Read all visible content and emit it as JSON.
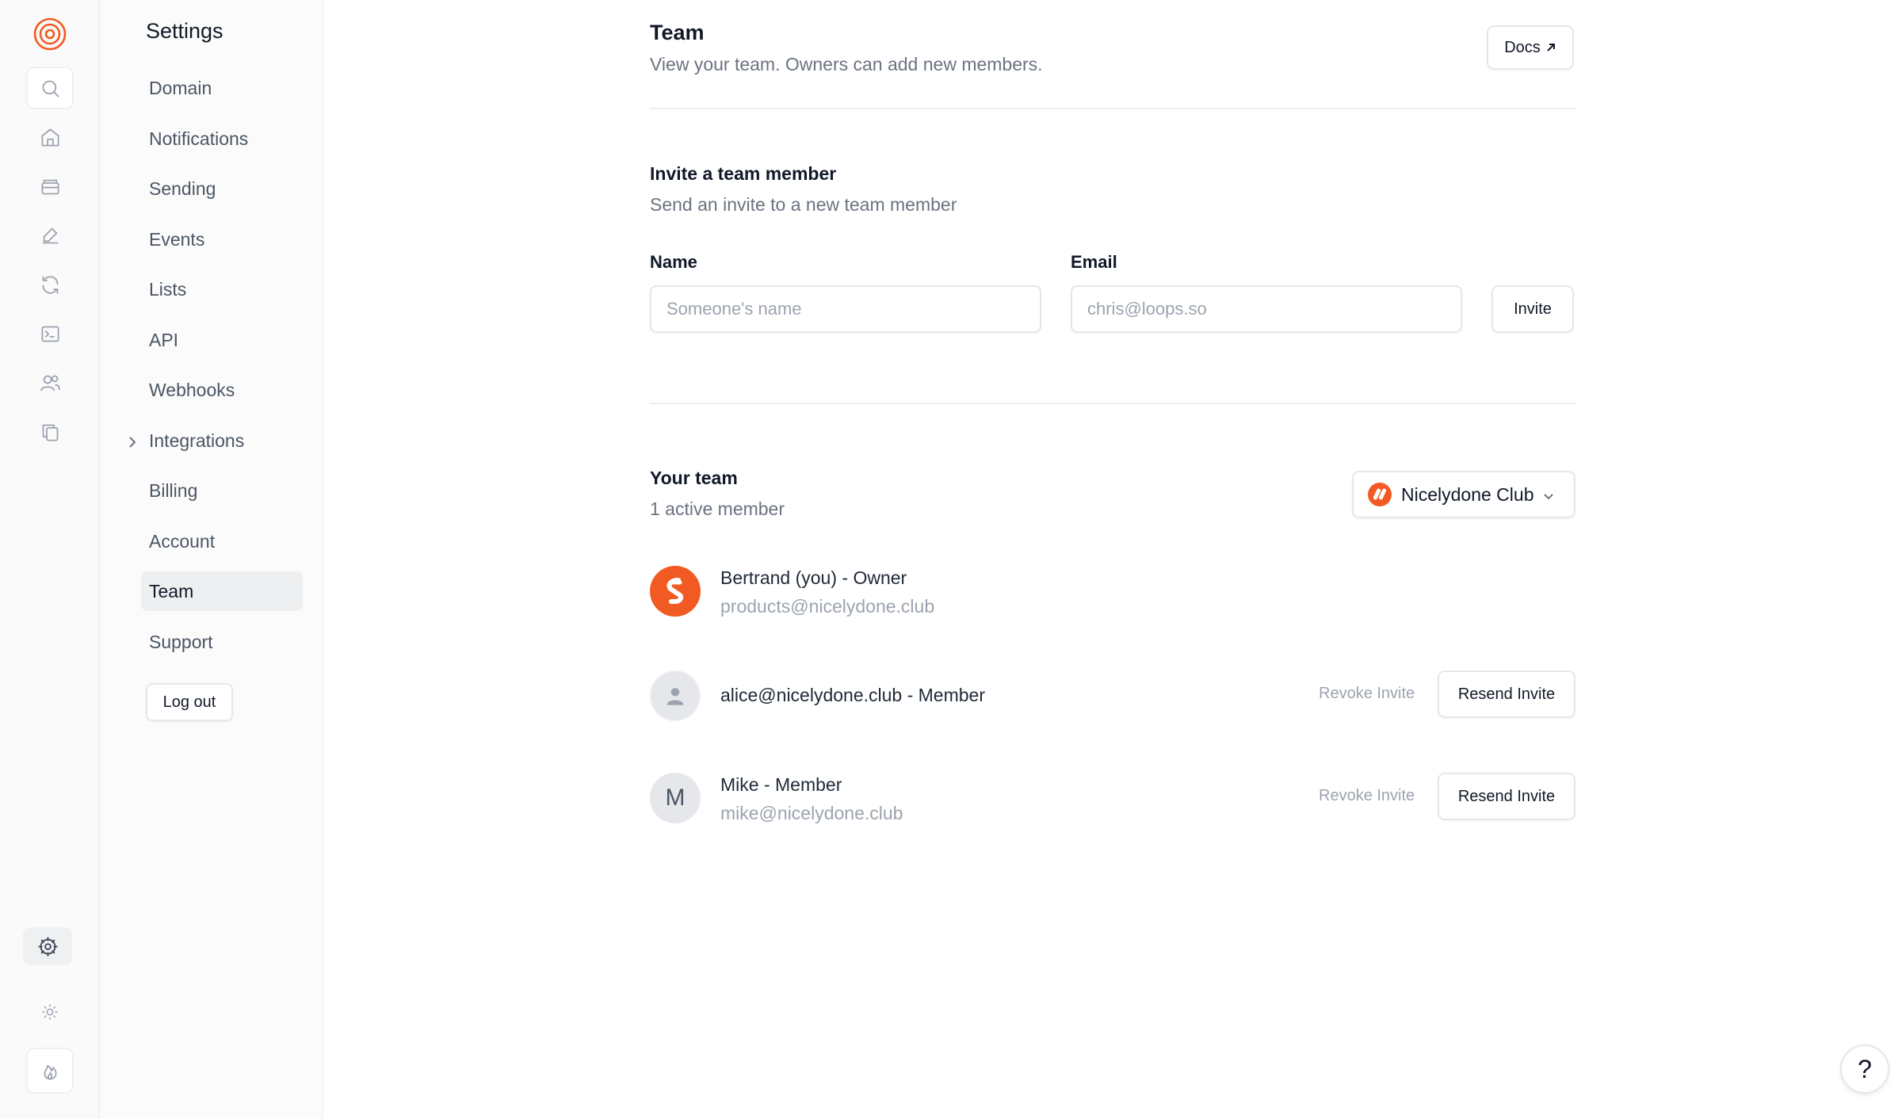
{
  "rail": {
    "icons": [
      "logo-icon",
      "search-icon",
      "home-icon",
      "inbox-icon",
      "edit-icon",
      "refresh-icon",
      "terminal-icon",
      "users-icon",
      "copy-icon",
      "settings-icon",
      "sun-icon",
      "fire-icon"
    ]
  },
  "sidebar": {
    "title": "Settings",
    "items": [
      {
        "label": "Domain"
      },
      {
        "label": "Notifications"
      },
      {
        "label": "Sending"
      },
      {
        "label": "Events"
      },
      {
        "label": "Lists"
      },
      {
        "label": "API"
      },
      {
        "label": "Webhooks"
      },
      {
        "label": "Integrations"
      },
      {
        "label": "Billing"
      },
      {
        "label": "Account"
      },
      {
        "label": "Team"
      },
      {
        "label": "Support"
      }
    ],
    "logout_label": "Log out"
  },
  "header": {
    "title": "Team",
    "subtitle": "View your team. Owners can add new members.",
    "docs_label": "Docs"
  },
  "invite": {
    "title": "Invite a team member",
    "subtitle": "Send an invite to a new team member",
    "name_label": "Name",
    "name_placeholder": "Someone's name",
    "email_label": "Email",
    "email_placeholder": "chris@loops.so",
    "button_label": "Invite"
  },
  "team": {
    "title": "Your team",
    "subtitle": "1 active member",
    "org_name": "Nicelydone Club",
    "members": [
      {
        "name": "Bertrand (you) - Owner",
        "email": "products@nicelydone.club"
      },
      {
        "name": "alice@nicelydone.club - Member",
        "revoke_label": "Revoke Invite",
        "resend_label": "Resend Invite"
      },
      {
        "name": "Mike - Member",
        "email": "mike@nicelydone.club",
        "initial": "M",
        "revoke_label": "Revoke Invite",
        "resend_label": "Resend Invite"
      }
    ]
  },
  "help_label": "?",
  "colors": {
    "brand": "#f15a22",
    "active_nav": "#eeeff1",
    "muted_text": "#6b7280"
  }
}
